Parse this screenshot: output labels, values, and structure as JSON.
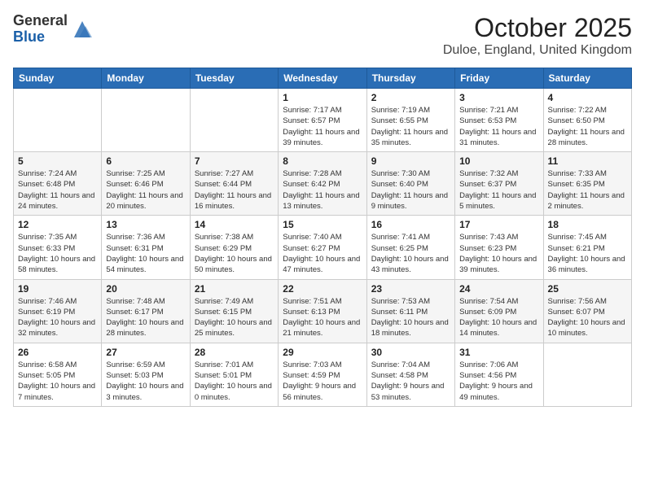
{
  "header": {
    "logo_general": "General",
    "logo_blue": "Blue",
    "title": "October 2025",
    "location": "Duloe, England, United Kingdom"
  },
  "calendar": {
    "days_of_week": [
      "Sunday",
      "Monday",
      "Tuesday",
      "Wednesday",
      "Thursday",
      "Friday",
      "Saturday"
    ],
    "weeks": [
      [
        {
          "day": "",
          "info": ""
        },
        {
          "day": "",
          "info": ""
        },
        {
          "day": "",
          "info": ""
        },
        {
          "day": "1",
          "info": "Sunrise: 7:17 AM\nSunset: 6:57 PM\nDaylight: 11 hours and 39 minutes."
        },
        {
          "day": "2",
          "info": "Sunrise: 7:19 AM\nSunset: 6:55 PM\nDaylight: 11 hours and 35 minutes."
        },
        {
          "day": "3",
          "info": "Sunrise: 7:21 AM\nSunset: 6:53 PM\nDaylight: 11 hours and 31 minutes."
        },
        {
          "day": "4",
          "info": "Sunrise: 7:22 AM\nSunset: 6:50 PM\nDaylight: 11 hours and 28 minutes."
        }
      ],
      [
        {
          "day": "5",
          "info": "Sunrise: 7:24 AM\nSunset: 6:48 PM\nDaylight: 11 hours and 24 minutes."
        },
        {
          "day": "6",
          "info": "Sunrise: 7:25 AM\nSunset: 6:46 PM\nDaylight: 11 hours and 20 minutes."
        },
        {
          "day": "7",
          "info": "Sunrise: 7:27 AM\nSunset: 6:44 PM\nDaylight: 11 hours and 16 minutes."
        },
        {
          "day": "8",
          "info": "Sunrise: 7:28 AM\nSunset: 6:42 PM\nDaylight: 11 hours and 13 minutes."
        },
        {
          "day": "9",
          "info": "Sunrise: 7:30 AM\nSunset: 6:40 PM\nDaylight: 11 hours and 9 minutes."
        },
        {
          "day": "10",
          "info": "Sunrise: 7:32 AM\nSunset: 6:37 PM\nDaylight: 11 hours and 5 minutes."
        },
        {
          "day": "11",
          "info": "Sunrise: 7:33 AM\nSunset: 6:35 PM\nDaylight: 11 hours and 2 minutes."
        }
      ],
      [
        {
          "day": "12",
          "info": "Sunrise: 7:35 AM\nSunset: 6:33 PM\nDaylight: 10 hours and 58 minutes."
        },
        {
          "day": "13",
          "info": "Sunrise: 7:36 AM\nSunset: 6:31 PM\nDaylight: 10 hours and 54 minutes."
        },
        {
          "day": "14",
          "info": "Sunrise: 7:38 AM\nSunset: 6:29 PM\nDaylight: 10 hours and 50 minutes."
        },
        {
          "day": "15",
          "info": "Sunrise: 7:40 AM\nSunset: 6:27 PM\nDaylight: 10 hours and 47 minutes."
        },
        {
          "day": "16",
          "info": "Sunrise: 7:41 AM\nSunset: 6:25 PM\nDaylight: 10 hours and 43 minutes."
        },
        {
          "day": "17",
          "info": "Sunrise: 7:43 AM\nSunset: 6:23 PM\nDaylight: 10 hours and 39 minutes."
        },
        {
          "day": "18",
          "info": "Sunrise: 7:45 AM\nSunset: 6:21 PM\nDaylight: 10 hours and 36 minutes."
        }
      ],
      [
        {
          "day": "19",
          "info": "Sunrise: 7:46 AM\nSunset: 6:19 PM\nDaylight: 10 hours and 32 minutes."
        },
        {
          "day": "20",
          "info": "Sunrise: 7:48 AM\nSunset: 6:17 PM\nDaylight: 10 hours and 28 minutes."
        },
        {
          "day": "21",
          "info": "Sunrise: 7:49 AM\nSunset: 6:15 PM\nDaylight: 10 hours and 25 minutes."
        },
        {
          "day": "22",
          "info": "Sunrise: 7:51 AM\nSunset: 6:13 PM\nDaylight: 10 hours and 21 minutes."
        },
        {
          "day": "23",
          "info": "Sunrise: 7:53 AM\nSunset: 6:11 PM\nDaylight: 10 hours and 18 minutes."
        },
        {
          "day": "24",
          "info": "Sunrise: 7:54 AM\nSunset: 6:09 PM\nDaylight: 10 hours and 14 minutes."
        },
        {
          "day": "25",
          "info": "Sunrise: 7:56 AM\nSunset: 6:07 PM\nDaylight: 10 hours and 10 minutes."
        }
      ],
      [
        {
          "day": "26",
          "info": "Sunrise: 6:58 AM\nSunset: 5:05 PM\nDaylight: 10 hours and 7 minutes."
        },
        {
          "day": "27",
          "info": "Sunrise: 6:59 AM\nSunset: 5:03 PM\nDaylight: 10 hours and 3 minutes."
        },
        {
          "day": "28",
          "info": "Sunrise: 7:01 AM\nSunset: 5:01 PM\nDaylight: 10 hours and 0 minutes."
        },
        {
          "day": "29",
          "info": "Sunrise: 7:03 AM\nSunset: 4:59 PM\nDaylight: 9 hours and 56 minutes."
        },
        {
          "day": "30",
          "info": "Sunrise: 7:04 AM\nSunset: 4:58 PM\nDaylight: 9 hours and 53 minutes."
        },
        {
          "day": "31",
          "info": "Sunrise: 7:06 AM\nSunset: 4:56 PM\nDaylight: 9 hours and 49 minutes."
        },
        {
          "day": "",
          "info": ""
        }
      ]
    ]
  }
}
